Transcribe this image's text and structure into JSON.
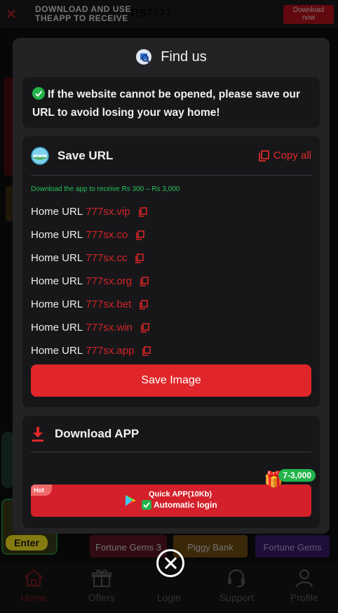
{
  "topbar": {
    "promo_line1": "DOWNLOAD AND USE",
    "promo_line2": "THEAPP TO RECEIVE",
    "promo_amount": "RS7777",
    "download_label_1": "Download",
    "download_label_2": "now"
  },
  "background": {
    "enter_label": "Enter",
    "games": [
      "Fortune Gems 3",
      "Piggy Bank",
      "Fortune Gems"
    ]
  },
  "bottom_nav": {
    "items": [
      {
        "label": "Home",
        "icon": "home-icon",
        "active": true
      },
      {
        "label": "Offers",
        "icon": "gift-icon",
        "active": false
      },
      {
        "label": "Login",
        "icon": "login-icon",
        "active": false
      },
      {
        "label": "Support",
        "icon": "headset-icon",
        "active": false
      },
      {
        "label": "Profile",
        "icon": "person-icon",
        "active": false
      }
    ]
  },
  "modal": {
    "title": "Find us",
    "notice": "If the website cannot be opened, please save our URL to avoid losing your way home!",
    "save_url": {
      "title": "Save URL",
      "copy_all": "Copy all",
      "note": "Download the app to receive Rs 300 – Rs 3,000",
      "urls": [
        {
          "label": "Home URL",
          "value": "777sx.vip"
        },
        {
          "label": "Home URL",
          "value": "777sx.co"
        },
        {
          "label": "Home URL",
          "value": "777sx.cc"
        },
        {
          "label": "Home URL",
          "value": "777sx.org"
        },
        {
          "label": "Home URL",
          "value": "777sx.bet"
        },
        {
          "label": "Home URL",
          "value": "777sx.win"
        },
        {
          "label": "Home URL",
          "value": "777sx.app"
        }
      ],
      "save_image": "Save Image"
    },
    "download_app": {
      "title": "Download APP",
      "hot_badge": "Hot",
      "app_title": "Quick APP(10Kb)",
      "app_sub": "Automatic login",
      "bonus": "7-3,000"
    }
  },
  "colors": {
    "accent_red": "#e0262a",
    "green": "#22b34a",
    "modal_bg": "#232326",
    "card_bg": "#17171a"
  }
}
